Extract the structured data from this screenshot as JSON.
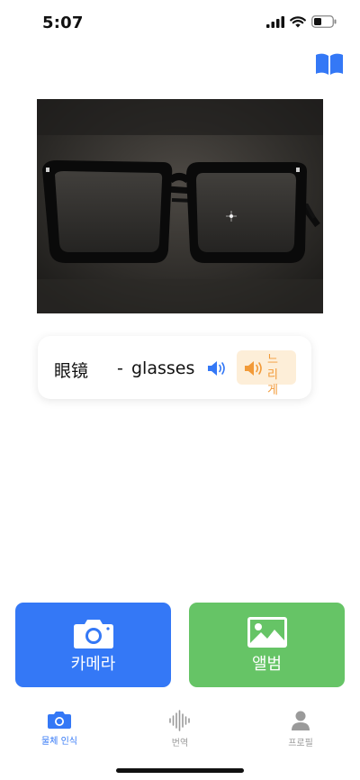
{
  "status_bar": {
    "time": "5:07",
    "signal_icon": "cellular-signal-icon",
    "wifi_icon": "wifi-icon",
    "battery_icon": "battery-icon"
  },
  "header": {
    "dictionary_icon": "book-icon"
  },
  "photo": {
    "subject": "glasses"
  },
  "result": {
    "word": "眼镜",
    "separator": "-",
    "translation": "glasses",
    "speak_icon": "speaker-icon",
    "slow_label": "느리게",
    "slow_icon": "speaker-icon"
  },
  "actions": {
    "camera_label": "카메라",
    "album_label": "앨범"
  },
  "tabs": [
    {
      "label": "물체 인식",
      "icon": "camera-icon",
      "active": true
    },
    {
      "label": "번역",
      "icon": "waveform-icon",
      "active": false
    },
    {
      "label": "프로필",
      "icon": "person-icon",
      "active": false
    }
  ],
  "colors": {
    "accent_blue": "#3478f6",
    "album_green": "#66c466",
    "slow_orange": "#f29a38",
    "slow_bg": "#fdeed8",
    "tab_inactive": "#9a9a9a"
  }
}
